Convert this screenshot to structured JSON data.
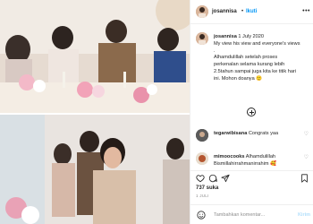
{
  "header": {
    "username": "josannisa",
    "separator": "•",
    "follow_label": "Ikuti"
  },
  "caption": {
    "username": "josannisa",
    "lines": [
      "1 July 2020",
      "My view his view and everyone's views",
      ".",
      "Alhamdulillah setelah proses",
      "perkenalan selama kurang lebih",
      "2.5tahun sampai juga kita ke titik hari",
      "ini. Mohon doanya 🙂"
    ]
  },
  "comments": [
    {
      "username": "tegarwibisana",
      "text": "Congrats yaa"
    },
    {
      "username": "mimoocooks",
      "text": "Alhamdulillah",
      "text2": "Bismillahirrahmanirrahim 🥰"
    }
  ],
  "likes": "737 suka",
  "date": "1 JULI",
  "add_comment": {
    "placeholder": "Tambahkan komentar...",
    "post_label": "Kirim"
  },
  "colors": {
    "accent": "#0095f6",
    "muted": "#8e8e8e",
    "border": "#efefef"
  }
}
